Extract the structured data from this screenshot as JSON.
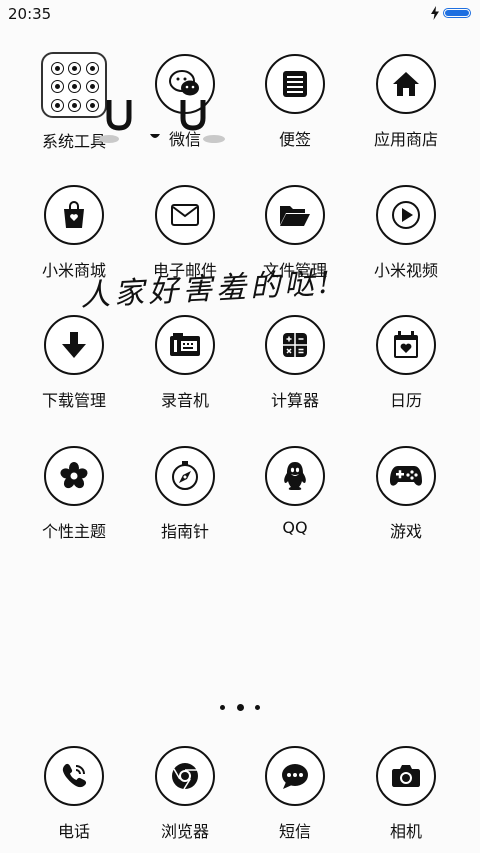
{
  "status_bar": {
    "time": "20:35",
    "battery_level": 1.0,
    "charging": true,
    "battery_color": "#1e6fe0"
  },
  "apps": [
    {
      "label": "系统工具",
      "icon": "folder-icon"
    },
    {
      "label": "微信",
      "icon": "wechat-icon"
    },
    {
      "label": "便签",
      "icon": "notes-icon"
    },
    {
      "label": "应用商店",
      "icon": "app-store-icon"
    },
    {
      "label": "小米商城",
      "icon": "shopping-bag-icon"
    },
    {
      "label": "电子邮件",
      "icon": "mail-icon"
    },
    {
      "label": "文件管理",
      "icon": "folder-open-icon"
    },
    {
      "label": "小米视频",
      "icon": "play-icon"
    },
    {
      "label": "下载管理",
      "icon": "download-icon"
    },
    {
      "label": "录音机",
      "icon": "recorder-icon"
    },
    {
      "label": "计算器",
      "icon": "calculator-icon"
    },
    {
      "label": "日历",
      "icon": "calendar-icon"
    },
    {
      "label": "个性主题",
      "icon": "flower-icon"
    },
    {
      "label": "指南针",
      "icon": "compass-icon"
    },
    {
      "label": "QQ",
      "icon": "penguin-icon"
    },
    {
      "label": "游戏",
      "icon": "gamepad-icon"
    }
  ],
  "overlay_text": "人家好害羞的哒!",
  "page_indicator": {
    "pages": 3,
    "current": 2
  },
  "dock": [
    {
      "label": "电话",
      "icon": "phone-icon"
    },
    {
      "label": "浏览器",
      "icon": "browser-icon"
    },
    {
      "label": "短信",
      "icon": "message-icon"
    },
    {
      "label": "相机",
      "icon": "camera-icon"
    }
  ]
}
